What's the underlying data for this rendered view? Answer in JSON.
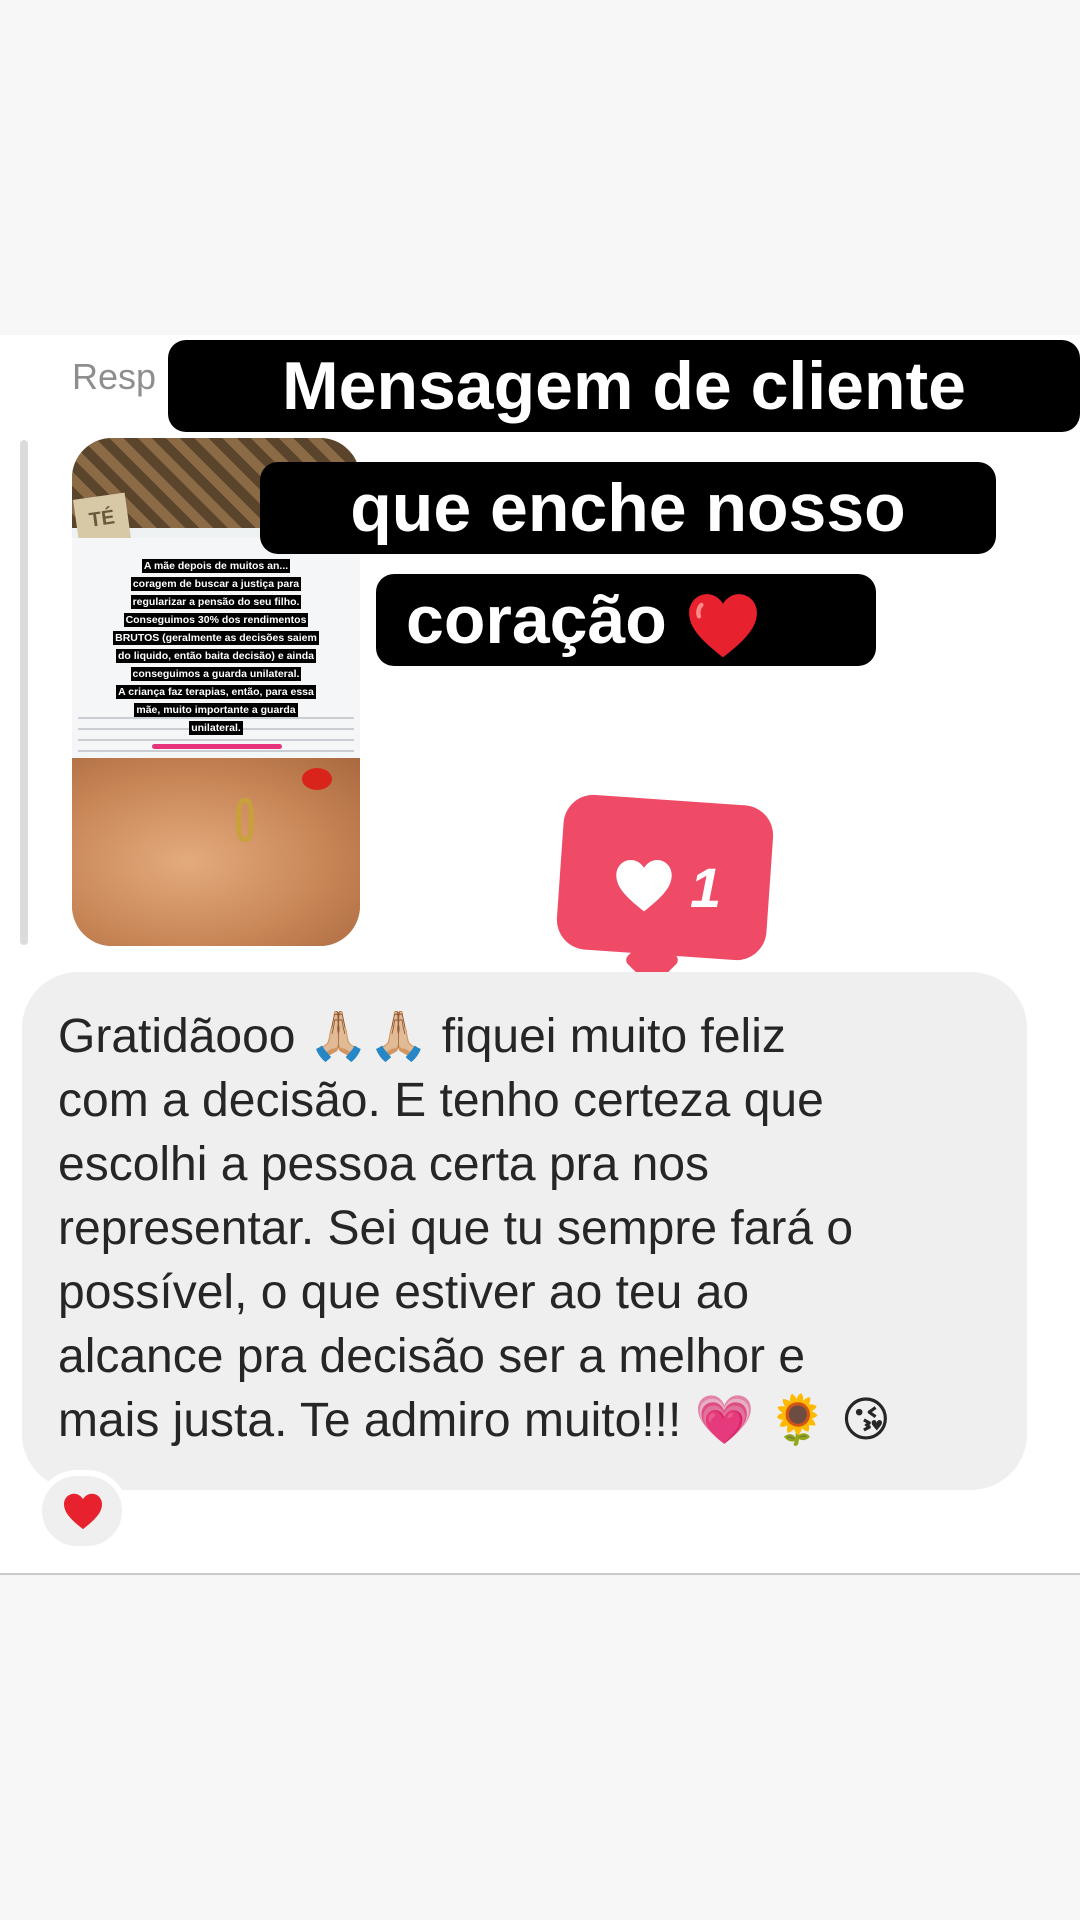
{
  "reply_label": "Resp",
  "story": {
    "tag": "TÉ",
    "caption_lines": [
      "A mãe depois de muitos an...",
      "coragem de buscar a justiça para",
      "regularizar a pensão do seu filho.",
      "Conseguimos 30% dos rendimentos",
      "BRUTOS (geralmente as decisões saiem",
      "do liquido, então baita decisão) e ainda",
      "conseguimos a guarda unilateral.",
      "A criança faz terapias, então, para essa",
      "mãe, muito importante a guarda",
      "unilateral."
    ]
  },
  "title": {
    "line1": "Mensagem de cliente",
    "line2": "que enche nosso",
    "line3": "coração",
    "heart_icon": "red-heart-icon"
  },
  "like": {
    "count": "1",
    "color": "#ef4b67"
  },
  "message": {
    "lines": [
      "Gratidãooo 🙏🏼🙏🏼 fiquei muito feliz",
      "com a decisão. E tenho certeza que",
      "escolhi a pessoa certa pra nos",
      "representar. Sei que tu sempre fará o",
      "possível, o que estiver ao teu ao",
      "alcance pra decisão ser a melhor e",
      "mais justa. Te admiro muito!!! 💗 🌻 😘"
    ]
  },
  "reaction": {
    "icon": "red-heart-icon",
    "color": "#e8212e"
  }
}
